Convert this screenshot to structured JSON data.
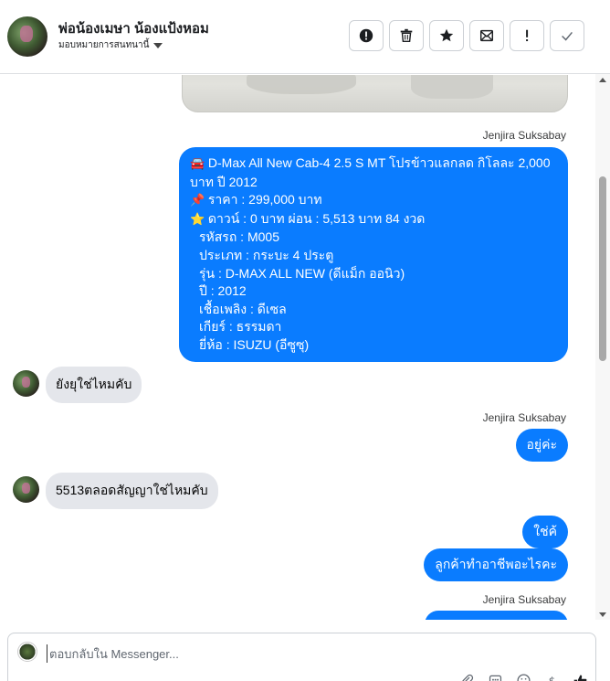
{
  "header": {
    "contact_name": "พ่อน้องเมษา น้องแป้งหอม",
    "assign_label": "มอบหมายการสนทนานี้",
    "actions": [
      {
        "name": "mark-spam-button",
        "icon": "alert-circle-icon"
      },
      {
        "name": "delete-button",
        "icon": "trash-icon"
      },
      {
        "name": "star-button",
        "icon": "star-icon"
      },
      {
        "name": "mark-unread-button",
        "icon": "envelope-icon"
      },
      {
        "name": "follow-up-button",
        "icon": "exclamation-icon"
      },
      {
        "name": "mark-done-button",
        "icon": "check-icon"
      }
    ]
  },
  "messages": {
    "sender_1": "Jenjira Suksabay",
    "car_post": {
      "title": "D-Max All New Cab-4 2.5 S MT โปรข้าวแลกลด กิโลละ 2,000",
      "title_line2": "บาท ปี 2012",
      "price_emoji": "📌",
      "price": "ราคา : 299,000 บาท",
      "car_emoji": "🚘",
      "down_emoji": "⭐",
      "down": "ดาวน์ : 0 บาท ผ่อน : 5,513 บาท 84 งวด",
      "code": "รหัสรถ : M005",
      "type": "ประเภท : กระบะ 4 ประตู",
      "model": "รุ่น : D-MAX ALL NEW (ดีแม็ก ออนิว)",
      "year": "ปี : 2012",
      "fuel": "เชื้อเพลิง : ดีเซล",
      "gear": "เกียร์ : ธรรมดา",
      "brand": "ยี่ห้อ : ISUZU (อีซูซุ)"
    },
    "in_1": "ยังยุใช่ไหมคับ",
    "sender_2": "Jenjira Suksabay",
    "out_2": "อยู่ค่ะ",
    "in_2": "5513ตลอดสัญญาใช่ไหมคับ",
    "out_3": "ใช่ค้",
    "out_4": "ลูกค้าทำอาชีพอะไรคะ",
    "sender_3": "Jenjira Suksabay"
  },
  "composer": {
    "placeholder": "ตอบกลับใน Messenger..."
  },
  "colors": {
    "outgoing_bubble": "#0a7cff",
    "incoming_bubble": "#e4e6eb"
  }
}
